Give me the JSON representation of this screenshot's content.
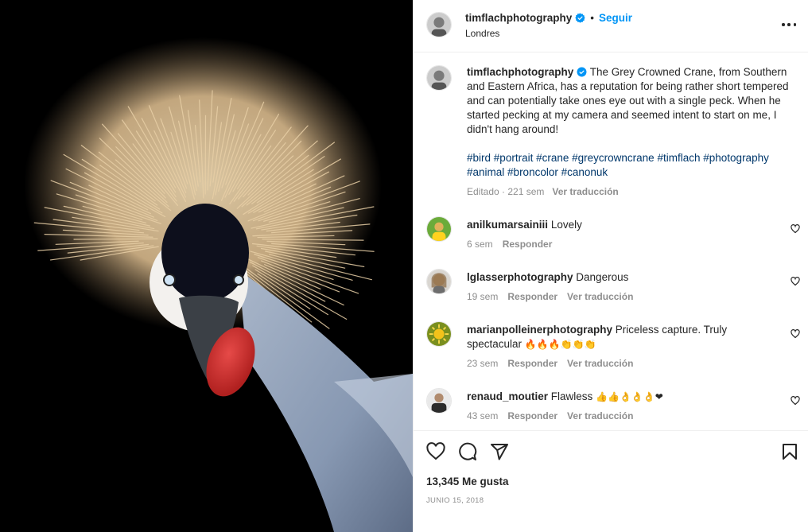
{
  "post": {
    "username": "timflachphotography",
    "follow_label": "Seguir",
    "separator": "•",
    "location": "Londres",
    "more_icon": "more-horizontal-icon",
    "verified_color": "#0095f6"
  },
  "caption": {
    "username": "timflachphotography",
    "text": "The Grey Crowned Crane, from Southern and Eastern Africa, has a reputation for being rather short tempered and can potentially take ones eye out with a single peck. When he started pecking at my camera and seemed intent to start on me, I didn't hang around!",
    "hashtags": [
      "#bird",
      "#portrait",
      "#crane",
      "#greycrowncrane",
      "#timflach",
      "#photography",
      "#animal",
      "#broncolor",
      "#canonuk"
    ],
    "meta": "Editado · 221 sem",
    "translate_label": "Ver traducción"
  },
  "comments": [
    {
      "username": "anilkumarsainiii",
      "text": "Lovely",
      "time": "6 sem",
      "reply_label": "Responder",
      "translate_label": ""
    },
    {
      "username": "lglasserphotography",
      "text": "Dangerous",
      "time": "19 sem",
      "reply_label": "Responder",
      "translate_label": "Ver traducción"
    },
    {
      "username": "marianpolleinerphotography",
      "text": "Priceless capture. Truly spectacular",
      "emoji": "🔥🔥🔥👏👏👏",
      "time": "23 sem",
      "reply_label": "Responder",
      "translate_label": "Ver traducción"
    },
    {
      "username": "renaud_moutier",
      "text": "Flawless",
      "emoji": "👍👍👌👌👌❤",
      "time": "43 sem",
      "reply_label": "Responder",
      "translate_label": "Ver traducción"
    }
  ],
  "actions": {
    "like_icon": "heart-icon",
    "comment_icon": "comment-icon",
    "share_icon": "send-icon",
    "save_icon": "bookmark-icon",
    "likes": "13,345 Me gusta",
    "date": "JUNIO 15, 2018"
  }
}
